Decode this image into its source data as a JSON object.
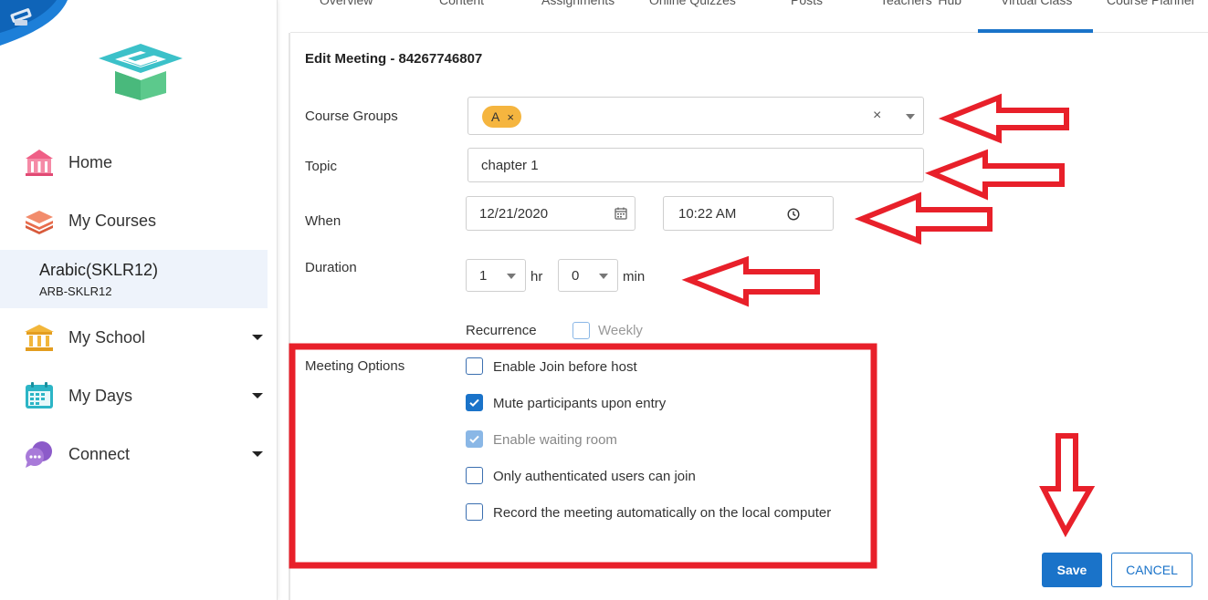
{
  "sidebar": {
    "items": [
      {
        "label": "Home"
      },
      {
        "label": "My Courses"
      },
      {
        "label": "My School"
      },
      {
        "label": "My Days"
      },
      {
        "label": "Connect"
      }
    ],
    "active_course": {
      "name": "Arabic(SKLR12)",
      "code": "ARB-SKLR12"
    }
  },
  "tabs": [
    {
      "label": "Overview"
    },
    {
      "label": "Content"
    },
    {
      "label": "Assignments"
    },
    {
      "label": "Online Quizzes"
    },
    {
      "label": "Posts"
    },
    {
      "label": "Teachers' Hub"
    },
    {
      "label": "Virtual Class"
    },
    {
      "label": "Course Planner"
    }
  ],
  "form": {
    "title": "Edit Meeting - 84267746807",
    "course_groups": {
      "label": "Course Groups",
      "chip": "A",
      "chip_remove": "×",
      "clear": "×"
    },
    "topic": {
      "label": "Topic",
      "value": "chapter 1"
    },
    "when": {
      "label": "When",
      "date": "12/21/2020",
      "time": "10:22 AM"
    },
    "duration": {
      "label": "Duration",
      "hours": "1",
      "hours_unit": "hr",
      "minutes": "0",
      "minutes_unit": "min"
    },
    "recurrence": {
      "label": "Recurrence",
      "option": "Weekly"
    },
    "meeting_options": {
      "label": "Meeting Options",
      "options": [
        {
          "label": "Enable Join before host",
          "checked": false
        },
        {
          "label": "Mute participants upon entry",
          "checked": true
        },
        {
          "label": "Enable waiting room",
          "checked": true,
          "disabled": true
        },
        {
          "label": "Only authenticated users can join",
          "checked": false
        },
        {
          "label": "Record the meeting automatically on the local computer",
          "checked": false
        }
      ]
    },
    "save_label": "Save",
    "cancel_label": "CANCEL"
  },
  "colors": {
    "primary": "#1a73c9",
    "chip": "#f5b53f",
    "annotation_red": "#e8202a"
  }
}
